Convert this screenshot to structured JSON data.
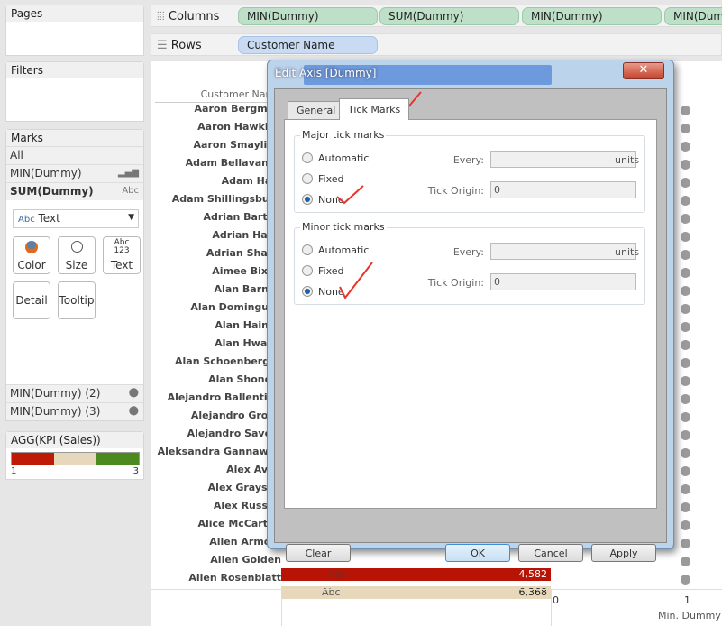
{
  "left_panel": {
    "pages": "Pages",
    "filters": "Filters",
    "marks": {
      "title": "Marks",
      "items": [
        {
          "label": "All"
        },
        {
          "label": "MIN(Dummy)",
          "icon": "bar-chart-icon"
        },
        {
          "label": "SUM(Dummy)",
          "icon": "Abc"
        }
      ],
      "mark_type": "Text",
      "mark_type_icon": "Abc",
      "buttons": [
        "Color",
        "Size",
        "Text",
        "Detail",
        "Tooltip"
      ],
      "text_button_icon": "Abc\n123",
      "extra_items": [
        "MIN(Dummy) (2)",
        "MIN(Dummy) (3)"
      ]
    },
    "legend": {
      "title": "AGG(KPI (Sales))",
      "min": "1",
      "max": "3",
      "colors": [
        "#be1a06",
        "#e8d8bb",
        "#4a8a1e"
      ]
    }
  },
  "shelves": {
    "columns_label": "Columns",
    "columns": [
      "MIN(Dummy)",
      "SUM(Dummy)",
      "MIN(Dummy)",
      "MIN(Dummy)"
    ],
    "rows_label": "Rows",
    "rows": [
      "Customer Name"
    ]
  },
  "view": {
    "header": "Customer Name",
    "customers": [
      "Aaron Bergman",
      "Aaron Hawkins",
      "Aaron Smayling",
      "Adam Bellavance",
      "Adam Hart",
      "Adam Shillingsburg",
      "Adrian Barton",
      "Adrian Hane",
      "Adrian Shami",
      "Aimee Bixby",
      "Alan Barnes",
      "Alan Dominguez",
      "Alan Haines",
      "Alan Hwang",
      "Alan Schoenberger",
      "Alan Shonely",
      "Alejandro Ballentine",
      "Alejandro Grove",
      "Alejandro Savely",
      "Aleksandra Gannaway",
      "Alex Avila",
      "Alex Grayson",
      "Alex Russell",
      "Alice McCarthy",
      "Allen Armold",
      "Allen Golden",
      "Allen Rosenblatt"
    ],
    "visible_bars": [
      {
        "customer": "Allen Golden",
        "label": "Abc",
        "value": "4,582",
        "color": "#b81405"
      },
      {
        "customer": "Allen Rosenblatt",
        "label": "Abc",
        "value": "6,368",
        "color": "#e8d8bb"
      }
    ],
    "axis": {
      "ticks": [
        "0",
        "1"
      ],
      "title": "Min. Dummy"
    }
  },
  "dialog": {
    "title": "Edit Axis [Dummy]",
    "close": "✕",
    "tabs": [
      "General",
      "Tick Marks"
    ],
    "active_tab": "Tick Marks",
    "major": {
      "title": "Major tick marks",
      "options": [
        "Automatic",
        "Fixed",
        "None"
      ],
      "selected": "None",
      "every_label": "Every:",
      "every_value": "",
      "units": "units",
      "origin_label": "Tick Origin:",
      "origin_value": "0"
    },
    "minor": {
      "title": "Minor tick marks",
      "options": [
        "Automatic",
        "Fixed",
        "None"
      ],
      "selected": "None",
      "every_label": "Every:",
      "every_value": "",
      "units": "units",
      "origin_label": "Tick Origin:",
      "origin_value": "0"
    },
    "buttons": {
      "clear": "Clear",
      "ok": "OK",
      "cancel": "Cancel",
      "apply": "Apply"
    }
  }
}
